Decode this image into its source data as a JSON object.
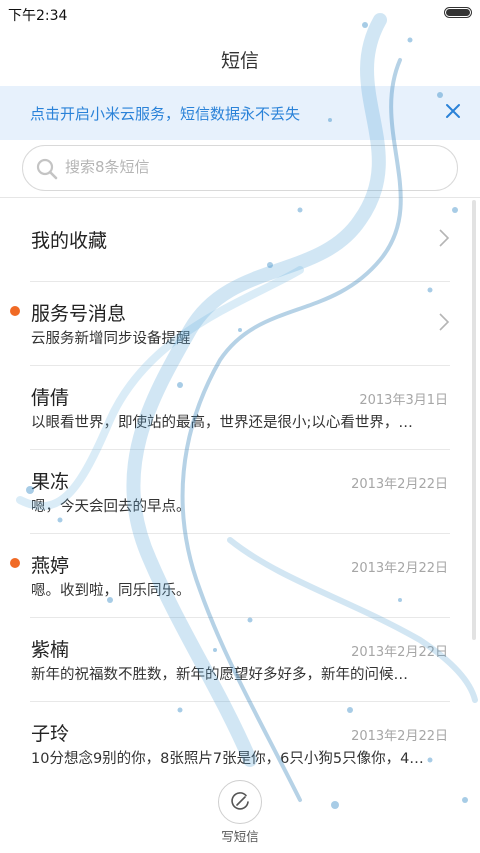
{
  "status_bar": {
    "time": "下午2:34"
  },
  "header": {
    "title": "短信"
  },
  "banner": {
    "text": "点击开启小米云服务，短信数据永不丢失",
    "close_icon": "close-icon"
  },
  "search": {
    "placeholder": "搜索8条短信",
    "value": ""
  },
  "conversations": [
    {
      "name": "我的收藏",
      "preview": "",
      "date": "",
      "unread": false,
      "chevron": true
    },
    {
      "name": "服务号消息",
      "preview": "云服务新增同步设备提醒",
      "date": "",
      "unread": true,
      "chevron": true
    },
    {
      "name": "倩倩",
      "preview": "以眼看世界，即使站的最高，世界还是很小;以心看世界，…",
      "date": "2013年3月1日",
      "unread": false,
      "chevron": false
    },
    {
      "name": "果冻",
      "preview": "嗯，今天会回去的早点。",
      "date": "2013年2月22日",
      "unread": false,
      "chevron": false
    },
    {
      "name": "燕婷",
      "preview": "嗯。收到啦，同乐同乐。",
      "date": "2013年2月22日",
      "unread": true,
      "chevron": false
    },
    {
      "name": "紫楠",
      "preview": "新年的祝福数不胜数，新年的愿望好多好多，新年的问候…",
      "date": "2013年2月22日",
      "unread": false,
      "chevron": false
    },
    {
      "name": "子玲",
      "preview": "10分想念9别的你，8张照片7张是你，6只小狗5只像你，4…",
      "date": "2013年2月22日",
      "unread": false,
      "chevron": false
    }
  ],
  "compose": {
    "label": "写短信",
    "icon": "compose-icon"
  },
  "colors": {
    "accent": "#2a82d8",
    "unread": "#f06a25",
    "banner_bg": "#e7f1fc"
  }
}
